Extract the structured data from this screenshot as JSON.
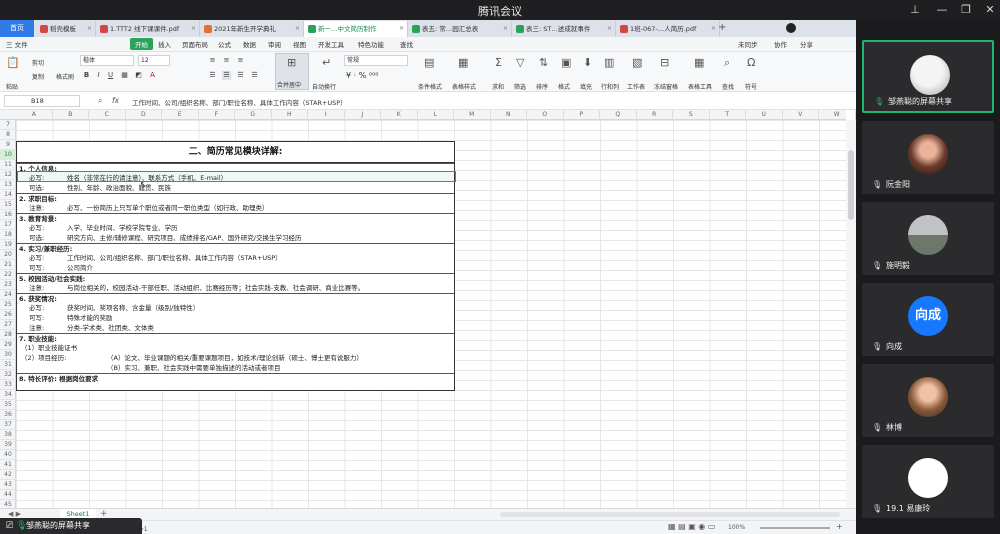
{
  "meeting": {
    "title": "腾讯会议",
    "share_label": "邹燕聪的屏幕共享"
  },
  "wps": {
    "home_tab": "首页",
    "tabs": [
      {
        "label": "稻壳模板",
        "color": "#d64545"
      },
      {
        "label": "1.TTT2 线下课课件.pdf",
        "color": "#d64545"
      },
      {
        "label": "2021年新生开学典礼",
        "color": "#e2702f"
      },
      {
        "label": "新一…中文简历制作",
        "color": "#2aa35a",
        "active": true
      },
      {
        "label": "表五: 常…园汇总表",
        "color": "#2aa35a"
      },
      {
        "label": "表三: ST…述成就事件",
        "color": "#2aa35a"
      },
      {
        "label": "1班-067-…人简历.pdf",
        "color": "#d64545"
      }
    ],
    "menus": [
      "三 文件",
      "开始",
      "插入",
      "页面布局",
      "公式",
      "数据",
      "审阅",
      "视图",
      "开发工具",
      "特色功能",
      "查找"
    ],
    "menu_right": [
      "未同步",
      "协作",
      "分享"
    ],
    "ribbon": {
      "paste": "粘贴",
      "cut": "剪切",
      "copy": "复制",
      "format_painter": "格式刷",
      "font": "楷体",
      "size": "12",
      "bold": "B",
      "italic": "I",
      "underline": "U",
      "merge": "合并居中",
      "wrap": "自动换行",
      "number_format": "常规",
      "cond_format": "条件格式",
      "table_style": "表格样式",
      "sum": "求和",
      "filter": "筛选",
      "sort": "排序",
      "format": "格式",
      "fill": "填充",
      "rowcol": "行和列",
      "worksheet": "工作表",
      "freeze": "冻结窗格",
      "table_tools": "表格工具",
      "find": "查找",
      "symbol": "符号"
    },
    "formula": {
      "cell_ref": "B18",
      "fx": "fx",
      "content": "工作时间、公司/组织名称、部门/职位名称、具体工作内容（STAR+USP）"
    },
    "columns": [
      "A",
      "B",
      "C",
      "D",
      "E",
      "F",
      "G",
      "H",
      "I",
      "J",
      "K",
      "L",
      "M",
      "N",
      "O",
      "P",
      "Q",
      "R",
      "S",
      "T",
      "U",
      "V",
      "W"
    ],
    "rows": [
      "7",
      "8",
      "9",
      "10",
      "11",
      "12",
      "13",
      "14",
      "15",
      "16",
      "17",
      "18",
      "19",
      "20",
      "21",
      "22",
      "23",
      "24",
      "25",
      "26",
      "27",
      "28",
      "29",
      "30",
      "31",
      "32",
      "33",
      "34",
      "35",
      "36",
      "37",
      "38",
      "39",
      "40",
      "41",
      "42",
      "43",
      "44",
      "45",
      "46"
    ],
    "sheet_title": "二、简历常见模块详解:",
    "content_rows": [
      {
        "kind": "sec",
        "text": "1. 个人信息:"
      },
      {
        "kind": "item",
        "label": "必写:",
        "value": "姓名（非常在行的请注意）、联系方式（手机、E-mail）"
      },
      {
        "kind": "item",
        "label": "可选:",
        "value": "性别、年龄、政治面貌、籍贯、民族"
      },
      {
        "kind": "sec",
        "text": "2. 求职目标:"
      },
      {
        "kind": "item",
        "label": "注意:",
        "value": "必写、一份简历上只写单个职位或者同一职位类型（如行政、助理类）"
      },
      {
        "kind": "sec",
        "text": "3. 教育背景:"
      },
      {
        "kind": "item",
        "label": "必写:",
        "value": "入学、毕业时间、学校学院专业、学历"
      },
      {
        "kind": "item",
        "label": "可选:",
        "value": "研究方向、主修/辅修课程、研究项目、成绩排名/GAP、国外研究/交换生学习经历"
      },
      {
        "kind": "sec",
        "text": "4. 实习/兼职经历:"
      },
      {
        "kind": "item",
        "label": "必写:",
        "value": "工作时间、公司/组织名称、部门/职位名称、具体工作内容（STAR+USP）"
      },
      {
        "kind": "item",
        "label": "可写:",
        "value": "公司简介"
      },
      {
        "kind": "sec",
        "text": "5. 校园活动/社会实践:"
      },
      {
        "kind": "item",
        "label": "注意:",
        "value": "与岗位相关的，校园活动-干部任职、活动组织、比赛经历等；社会实践-支教、社会调研、商业比赛等。"
      },
      {
        "kind": "sec",
        "text": "6. 获奖情况:"
      },
      {
        "kind": "item",
        "label": "必写:",
        "value": "获奖时间、奖项名称、含金量（级别/独特性）"
      },
      {
        "kind": "item",
        "label": "可写:",
        "value": "特殊才能的奖励"
      },
      {
        "kind": "item",
        "label": "注意:",
        "value": "分类-学术类、社团类、文体类"
      },
      {
        "kind": "sec",
        "text": "7. 职业技能:"
      },
      {
        "kind": "sub",
        "label": "（1）职业技能证书",
        "value": ""
      },
      {
        "kind": "sub",
        "label": "（2）项目经历:",
        "value": "（A）论文、毕业课题的相关/重要课题项目，如技术/理论创新（硕士、博士更有说服力）"
      },
      {
        "kind": "sub",
        "label": "",
        "value": "（B）实习、兼职、社会实践中需要单独描述的活动或者项目"
      },
      {
        "kind": "sec",
        "text": "8. 特长评价: 根据岗位要求"
      }
    ],
    "sheet_tab": "Sheet1",
    "status": {
      "left": "=0  计数=1",
      "zoom": "100%"
    }
  },
  "participants": [
    {
      "name": "邹燕聪的屏幕共享",
      "active": true,
      "avatar": "cat"
    },
    {
      "name": "阮金阳",
      "avatar": "photo"
    },
    {
      "name": "施明毅",
      "avatar": "scenery"
    },
    {
      "name": "向成",
      "avatar": "letter",
      "letter": "向成"
    },
    {
      "name": "林博",
      "avatar": "person"
    },
    {
      "name": "19.1 易康玲",
      "avatar": "sketch"
    }
  ]
}
